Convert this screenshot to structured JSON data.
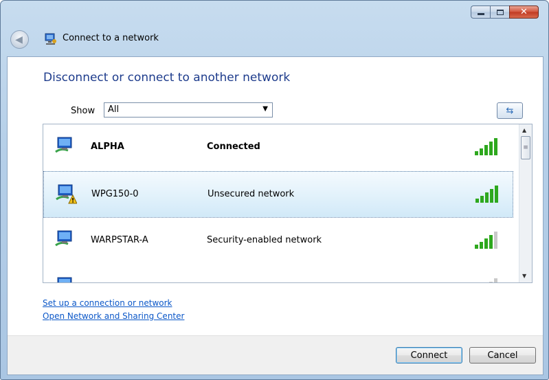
{
  "window": {
    "title": "Connect to a network",
    "caption_buttons": [
      "minimize",
      "maximize",
      "close"
    ]
  },
  "main": {
    "heading": "Disconnect or connect to another network",
    "show_label": "Show",
    "filter_selected": "All",
    "networks": [
      {
        "name": "ALPHA",
        "status": "Connected",
        "bold": true,
        "signal_bars": 5,
        "secured": true
      },
      {
        "name": "WPG150-0",
        "status": "Unsecured network",
        "bold": false,
        "signal_bars": 5,
        "secured": false,
        "selected": true
      },
      {
        "name": "WARPSTAR-A",
        "status": "Security-enabled network",
        "bold": false,
        "signal_bars": 4,
        "secured": true
      },
      {
        "name": "",
        "status": "",
        "bold": false,
        "signal_bars": 1,
        "partially_visible": true
      }
    ],
    "links": {
      "setup": "Set up a connection or network",
      "network_center": "Open Network and Sharing Center"
    }
  },
  "footer": {
    "connect_label": "Connect",
    "cancel_label": "Cancel"
  },
  "colors": {
    "heading": "#1e3c8c",
    "link": "#0b57c8",
    "signal_active": "#2ea81e",
    "selection": "#d1e9f8"
  }
}
